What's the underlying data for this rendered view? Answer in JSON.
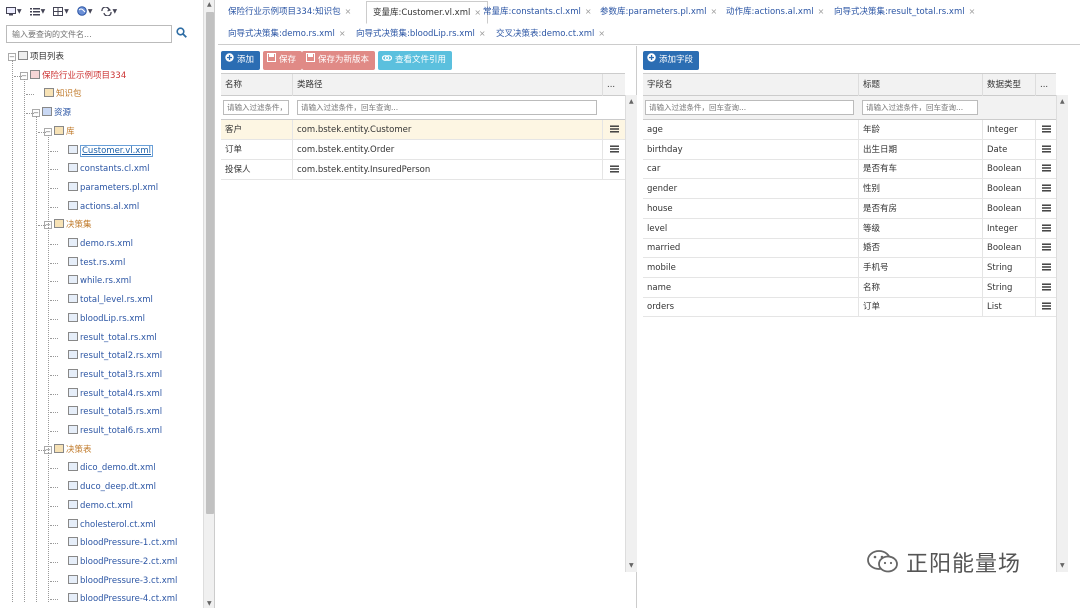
{
  "left": {
    "search_placeholder": "输入要查询的文件名...",
    "tree": [
      {
        "label": "项目列表",
        "depth": 0,
        "type": "root",
        "expanded": true
      },
      {
        "label": "保险行业示例项目334",
        "depth": 1,
        "type": "project",
        "expanded": true
      },
      {
        "label": "知识包",
        "depth": 2,
        "type": "folder"
      },
      {
        "label": "资源",
        "depth": 2,
        "type": "resource",
        "expanded": true
      },
      {
        "label": "库",
        "depth": 3,
        "type": "folder",
        "expanded": true
      },
      {
        "label": "Customer.vl.xml",
        "depth": 4,
        "type": "file",
        "selected": true
      },
      {
        "label": "constants.cl.xml",
        "depth": 4,
        "type": "file"
      },
      {
        "label": "parameters.pl.xml",
        "depth": 4,
        "type": "file"
      },
      {
        "label": "actions.al.xml",
        "depth": 4,
        "type": "file"
      },
      {
        "label": "决策集",
        "depth": 3,
        "type": "folder",
        "expanded": true
      },
      {
        "label": "demo.rs.xml",
        "depth": 4,
        "type": "file"
      },
      {
        "label": "test.rs.xml",
        "depth": 4,
        "type": "file"
      },
      {
        "label": "while.rs.xml",
        "depth": 4,
        "type": "file"
      },
      {
        "label": "total_level.rs.xml",
        "depth": 4,
        "type": "file"
      },
      {
        "label": "bloodLip.rs.xml",
        "depth": 4,
        "type": "file"
      },
      {
        "label": "result_total.rs.xml",
        "depth": 4,
        "type": "file"
      },
      {
        "label": "result_total2.rs.xml",
        "depth": 4,
        "type": "file"
      },
      {
        "label": "result_total3.rs.xml",
        "depth": 4,
        "type": "file"
      },
      {
        "label": "result_total4.rs.xml",
        "depth": 4,
        "type": "file"
      },
      {
        "label": "result_total5.rs.xml",
        "depth": 4,
        "type": "file"
      },
      {
        "label": "result_total6.rs.xml",
        "depth": 4,
        "type": "file"
      },
      {
        "label": "决策表",
        "depth": 3,
        "type": "folder",
        "expanded": true
      },
      {
        "label": "dico_demo.dt.xml",
        "depth": 4,
        "type": "file"
      },
      {
        "label": "duco_deep.dt.xml",
        "depth": 4,
        "type": "file"
      },
      {
        "label": "demo.ct.xml",
        "depth": 4,
        "type": "file"
      },
      {
        "label": "cholesterol.ct.xml",
        "depth": 4,
        "type": "file"
      },
      {
        "label": "bloodPressure-1.ct.xml",
        "depth": 4,
        "type": "file"
      },
      {
        "label": "bloodPressure-2.ct.xml",
        "depth": 4,
        "type": "file"
      },
      {
        "label": "bloodPressure-3.ct.xml",
        "depth": 4,
        "type": "file"
      },
      {
        "label": "bloodPressure-4.ct.xml",
        "depth": 4,
        "type": "file"
      }
    ]
  },
  "tabs": [
    {
      "label": "保险行业示例项目334:知识包",
      "active": false
    },
    {
      "label": "变量库:Customer.vl.xml",
      "active": true
    },
    {
      "label": "常量库:constants.cl.xml",
      "active": false
    },
    {
      "label": "参数库:parameters.pl.xml",
      "active": false
    },
    {
      "label": "动作库:actions.al.xml",
      "active": false
    },
    {
      "label": "向导式决策集:result_total.rs.xml",
      "active": false
    },
    {
      "label": "向导式决策集:demo.rs.xml",
      "active": false
    },
    {
      "label": "向导式决策集:bloodLip.rs.xml",
      "active": false
    },
    {
      "label": "交叉决策表:demo.ct.xml",
      "active": false
    }
  ],
  "tab_close": "×",
  "panel1": {
    "buttons": {
      "add": "添加",
      "save": "保存",
      "save_new": "保存为新版本",
      "view_refs": "查看文件引用"
    },
    "headers": {
      "name": "名称",
      "class_path": "类路径",
      "more": "..."
    },
    "filter_placeholder": "请输入过滤条件，回车查询...",
    "rows": [
      {
        "name": "客户",
        "class_path": "com.bstek.entity.Customer",
        "highlight": true
      },
      {
        "name": "订单",
        "class_path": "com.bstek.entity.Order",
        "highlight": false
      },
      {
        "name": "投保人",
        "class_path": "com.bstek.entity.InsuredPerson",
        "highlight": false
      }
    ]
  },
  "panel2": {
    "buttons": {
      "add_field": "添加字段"
    },
    "headers": {
      "field_name": "字段名",
      "title": "标题",
      "data_type": "数据类型",
      "more": "..."
    },
    "filter_placeholder": "请输入过滤条件，回车查询...",
    "rows": [
      {
        "field": "age",
        "title": "年龄",
        "type": "Integer"
      },
      {
        "field": "birthday",
        "title": "出生日期",
        "type": "Date"
      },
      {
        "field": "car",
        "title": "是否有车",
        "type": "Boolean"
      },
      {
        "field": "gender",
        "title": "性别",
        "type": "Boolean"
      },
      {
        "field": "house",
        "title": "是否有房",
        "type": "Boolean"
      },
      {
        "field": "level",
        "title": "等级",
        "type": "Integer"
      },
      {
        "field": "married",
        "title": "婚否",
        "type": "Boolean"
      },
      {
        "field": "mobile",
        "title": "手机号",
        "type": "String"
      },
      {
        "field": "name",
        "title": "名称",
        "type": "String"
      },
      {
        "field": "orders",
        "title": "订单",
        "type": "List"
      }
    ]
  },
  "watermark": "正阳能量场",
  "colors": {
    "primary": "#2b6db3",
    "danger": "#e08a86",
    "info": "#5bc0de",
    "link": "#2b55a4",
    "project": "#cc3333",
    "highlight_row": "#fdf6e3"
  }
}
